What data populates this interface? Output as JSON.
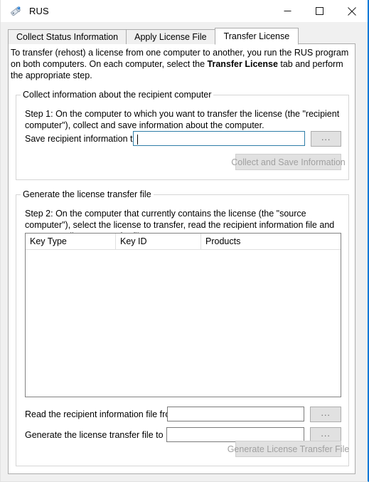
{
  "window": {
    "title": "RUS",
    "icon": "license-key-icon",
    "controls": {
      "minimize": "minimize-icon",
      "maximize": "maximize-icon",
      "close": "close-icon"
    }
  },
  "tabs": [
    {
      "label": "Collect Status Information",
      "active": false
    },
    {
      "label": "Apply License File",
      "active": false
    },
    {
      "label": "Transfer License",
      "active": true
    }
  ],
  "intro": {
    "line1_a": "To transfer (rehost) a license from one computer to another, you run the RUS program on both computers. On each computer, select the ",
    "emphasis": "Transfer License",
    "line1_b": " tab and perform the appropriate step."
  },
  "group1": {
    "legend": "Collect information about the recipient computer",
    "step_text": "Step 1: On the computer to which you want to transfer the license (the \"recipient computer\"), collect and save information about the computer.",
    "save_label": "Save recipient information to",
    "save_value": "",
    "save_placeholder": "",
    "browse_label": "...",
    "collect_button": "Collect and Save Information",
    "collect_button_enabled": "false"
  },
  "group2": {
    "legend": "Generate the license transfer file",
    "step_text": "Step 2: On the computer that currently contains the license (the \"source computer\"), select the license to transfer, read the recipient information file and generate a license transfer file.",
    "listview": {
      "columns": [
        "Key Type",
        "Key ID",
        "Products"
      ],
      "rows": []
    },
    "read_label": "Read the recipient information file from",
    "read_value": "",
    "read_browse_label": "...",
    "generate_label": "Generate the license transfer file to",
    "generate_value": "",
    "generate_browse_label": "...",
    "generate_button": "Generate License Transfer File",
    "generate_button_enabled": "false"
  },
  "colors": {
    "accent_border": "#0078d7",
    "focus_border": "#2f7ea8",
    "window_bg": "#f0f0f0",
    "panel_bg": "#ffffff",
    "disabled_text": "#a0a0a0"
  }
}
